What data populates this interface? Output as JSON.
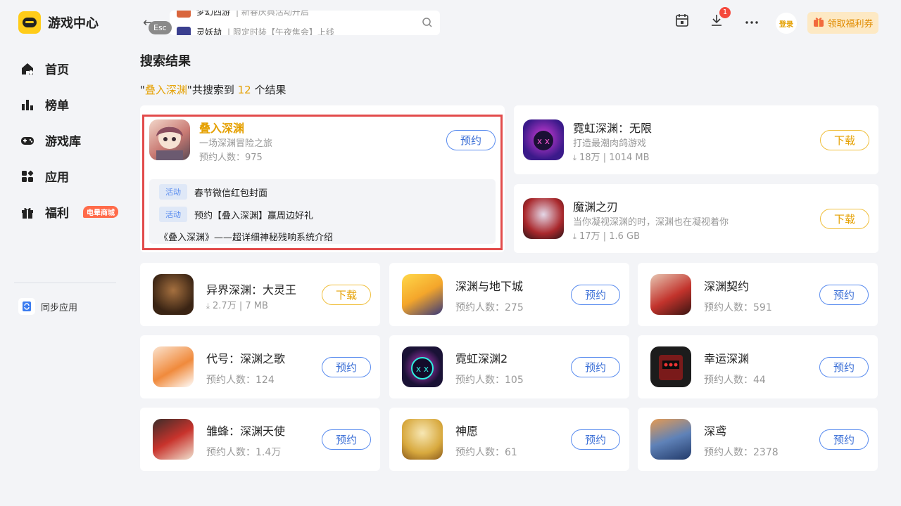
{
  "sidebar": {
    "brand": "游戏中心",
    "items": [
      {
        "label": "首页",
        "icon": "home-icon"
      },
      {
        "label": "榜单",
        "icon": "chart-icon"
      },
      {
        "label": "游戏库",
        "icon": "gamepad-icon"
      },
      {
        "label": "应用",
        "icon": "apps-icon"
      },
      {
        "label": "福利",
        "icon": "gift-icon",
        "badge": "电晕商城"
      }
    ],
    "sync_label": "同步应用"
  },
  "topbar": {
    "esc": "Esc",
    "suggestions": [
      {
        "name": "梦幻西游",
        "desc": "新春庆典活动开启"
      },
      {
        "name": "灵妖劫",
        "desc": "限定时装【午夜焦会】上线"
      }
    ],
    "download_count": "1",
    "login": "登录",
    "coupon": "领取福利券"
  },
  "page": {
    "title": "搜索结果",
    "summary": {
      "q_open": "\"",
      "query": "叠入深渊",
      "mid": "\"共搜索到 ",
      "count": "12",
      "tail": " 个结果"
    }
  },
  "featured": {
    "name": "叠入深渊",
    "desc": "一场深渊冒险之旅",
    "stat": "预约人数：975",
    "action": "预约",
    "activities": [
      {
        "tag": "活动",
        "text": "春节微信红包封面"
      },
      {
        "tag": "活动",
        "text": "预约【叠入深渊】赢周边好礼"
      },
      {
        "tag": "",
        "text": "《叠入深渊》——超详细神秘残响系统介绍"
      }
    ]
  },
  "side_games": [
    {
      "name": "霓虹深渊：无限",
      "desc": "打造最潮肉鸽游戏",
      "downloads": "18万",
      "size": "1014 MB",
      "action": "下载"
    },
    {
      "name": "魔渊之刃",
      "desc": "当你凝视深渊的时，深渊也在凝视着你",
      "downloads": "17万",
      "size": "1.6 GB",
      "action": "下载"
    }
  ],
  "grid": [
    {
      "name": "异界深渊：大灵王",
      "downloads": "2.7万",
      "size": "7 MB",
      "action": "下载"
    },
    {
      "name": "深渊与地下城",
      "stat": "预约人数：275",
      "action": "预约"
    },
    {
      "name": "深渊契约",
      "stat": "预约人数：591",
      "action": "预约"
    },
    {
      "name": "代号：深渊之歌",
      "stat": "预约人数：124",
      "action": "预约"
    },
    {
      "name": "霓虹深渊2",
      "stat": "预约人数：105",
      "action": "预约"
    },
    {
      "name": "幸运深渊",
      "stat": "预约人数：44",
      "action": "预约"
    },
    {
      "name": "雏蜂：深渊天使",
      "stat": "预约人数：1.4万",
      "action": "预约"
    },
    {
      "name": "神愿",
      "stat": "预约人数：61",
      "action": "预约"
    },
    {
      "name": "深鸢",
      "stat": "预约人数：2378",
      "action": "预约"
    }
  ],
  "colors": {
    "accent": "#e5a000",
    "book_blue": "#3b6fd6",
    "highlight_red": "#e24b4b"
  }
}
